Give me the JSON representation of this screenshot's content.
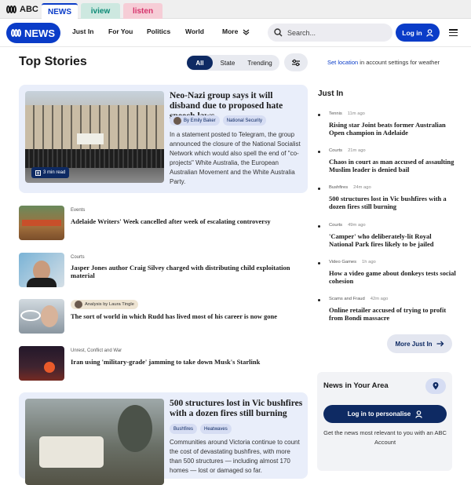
{
  "brand": {
    "abc": "ABC",
    "news_logo": "NEWS"
  },
  "network_tabs": [
    {
      "label": "NEWS"
    },
    {
      "label": "iview"
    },
    {
      "label": "listen"
    }
  ],
  "nav": {
    "items": [
      "Just In",
      "For You",
      "Politics",
      "World",
      "More"
    ],
    "search_placeholder": "Search...",
    "login_label": "Log in"
  },
  "top_stories": {
    "title": "Top Stories",
    "filters": [
      "All",
      "State",
      "Trending"
    ],
    "weather_link": "Set location",
    "weather_text": " in account settings for weather"
  },
  "lead": {
    "title": "Neo-Nazi group says it will disband due to proposed hate speech laws",
    "author": "By Emily Baker",
    "topic": "National Security",
    "read_time": "3 min read",
    "summary": "In a statement posted to Telegram, the group announced the closure of the National Socialist Network which would also spell the end of \"co-projects\" White Australia, the European Australian Movement and the White Australia Party."
  },
  "stories": [
    {
      "category": "Events",
      "title": "Adelaide Writers' Week cancelled after week of escalating controversy"
    },
    {
      "category": "Courts",
      "title": "Jasper Jones author Craig Silvey charged with distributing child exploitation material"
    },
    {
      "category": "Analysis by Laura Tingle",
      "title": "The sort of world in which Rudd has lived most of his career is now gone"
    },
    {
      "category": "Unrest, Conflict and War",
      "title": "Iran using 'military-grade' jamming to take down Musk's Starlink"
    }
  ],
  "feature2": {
    "title": "500 structures lost in Vic bushfires with a dozen fires still burning",
    "chips": [
      "Bushfires",
      "Heatwaves"
    ],
    "summary": "Communities around Victoria continue to count the cost of devastating bushfires, with more than 500 structures — including almost 170 homes — lost or damaged so far."
  },
  "just_in": {
    "title": "Just In",
    "items": [
      {
        "category": "Tennis",
        "age": "11m ago",
        "title": "Rising star Joint beats former Australian Open champion in Adelaide"
      },
      {
        "category": "Courts",
        "age": "21m ago",
        "title": "Chaos in court as man accused of assaulting Muslim leader is denied bail"
      },
      {
        "category": "Bushfires",
        "age": "24m ago",
        "title": "500 structures lost in Vic bushfires with a dozen fires still burning"
      },
      {
        "category": "Courts",
        "age": "49m ago",
        "title": "'Camper' who deliberately-lit Royal National Park fires likely to be jailed"
      },
      {
        "category": "Video Games",
        "age": "1h ago",
        "title": "How a video game about donkeys tests social cohesion"
      },
      {
        "category": "Scams and Fraud",
        "age": "42m ago",
        "title": "Online retailer accused of trying to profit from Bondi massacre"
      }
    ],
    "more_label": "More Just In"
  },
  "area": {
    "title": "News in Your Area",
    "login_label": "Log in to personalise",
    "text": "Get the news most relevant to you with an ABC Account"
  },
  "colors": {
    "brand_blue": "#0a3cc8",
    "navy": "#0e2a63",
    "card_bg": "#e9eefa"
  }
}
